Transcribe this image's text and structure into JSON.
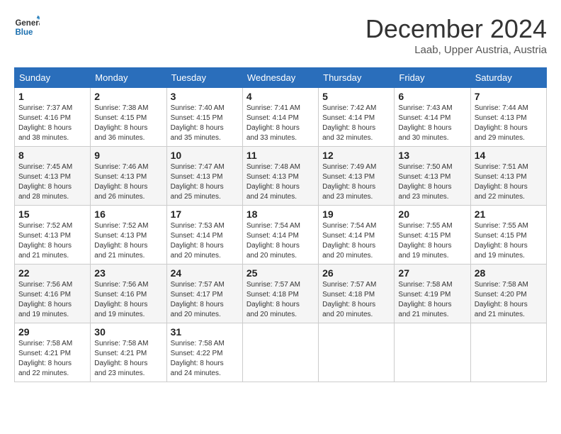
{
  "logo": {
    "line1": "General",
    "line2": "Blue"
  },
  "header": {
    "month": "December 2024",
    "location": "Laab, Upper Austria, Austria"
  },
  "days_of_week": [
    "Sunday",
    "Monday",
    "Tuesday",
    "Wednesday",
    "Thursday",
    "Friday",
    "Saturday"
  ],
  "weeks": [
    [
      {
        "day": "1",
        "sunrise": "7:37 AM",
        "sunset": "4:16 PM",
        "daylight": "8 hours and 38 minutes."
      },
      {
        "day": "2",
        "sunrise": "7:38 AM",
        "sunset": "4:15 PM",
        "daylight": "8 hours and 36 minutes."
      },
      {
        "day": "3",
        "sunrise": "7:40 AM",
        "sunset": "4:15 PM",
        "daylight": "8 hours and 35 minutes."
      },
      {
        "day": "4",
        "sunrise": "7:41 AM",
        "sunset": "4:14 PM",
        "daylight": "8 hours and 33 minutes."
      },
      {
        "day": "5",
        "sunrise": "7:42 AM",
        "sunset": "4:14 PM",
        "daylight": "8 hours and 32 minutes."
      },
      {
        "day": "6",
        "sunrise": "7:43 AM",
        "sunset": "4:14 PM",
        "daylight": "8 hours and 30 minutes."
      },
      {
        "day": "7",
        "sunrise": "7:44 AM",
        "sunset": "4:13 PM",
        "daylight": "8 hours and 29 minutes."
      }
    ],
    [
      {
        "day": "8",
        "sunrise": "7:45 AM",
        "sunset": "4:13 PM",
        "daylight": "8 hours and 28 minutes."
      },
      {
        "day": "9",
        "sunrise": "7:46 AM",
        "sunset": "4:13 PM",
        "daylight": "8 hours and 26 minutes."
      },
      {
        "day": "10",
        "sunrise": "7:47 AM",
        "sunset": "4:13 PM",
        "daylight": "8 hours and 25 minutes."
      },
      {
        "day": "11",
        "sunrise": "7:48 AM",
        "sunset": "4:13 PM",
        "daylight": "8 hours and 24 minutes."
      },
      {
        "day": "12",
        "sunrise": "7:49 AM",
        "sunset": "4:13 PM",
        "daylight": "8 hours and 23 minutes."
      },
      {
        "day": "13",
        "sunrise": "7:50 AM",
        "sunset": "4:13 PM",
        "daylight": "8 hours and 23 minutes."
      },
      {
        "day": "14",
        "sunrise": "7:51 AM",
        "sunset": "4:13 PM",
        "daylight": "8 hours and 22 minutes."
      }
    ],
    [
      {
        "day": "15",
        "sunrise": "7:52 AM",
        "sunset": "4:13 PM",
        "daylight": "8 hours and 21 minutes."
      },
      {
        "day": "16",
        "sunrise": "7:52 AM",
        "sunset": "4:13 PM",
        "daylight": "8 hours and 21 minutes."
      },
      {
        "day": "17",
        "sunrise": "7:53 AM",
        "sunset": "4:14 PM",
        "daylight": "8 hours and 20 minutes."
      },
      {
        "day": "18",
        "sunrise": "7:54 AM",
        "sunset": "4:14 PM",
        "daylight": "8 hours and 20 minutes."
      },
      {
        "day": "19",
        "sunrise": "7:54 AM",
        "sunset": "4:14 PM",
        "daylight": "8 hours and 20 minutes."
      },
      {
        "day": "20",
        "sunrise": "7:55 AM",
        "sunset": "4:15 PM",
        "daylight": "8 hours and 19 minutes."
      },
      {
        "day": "21",
        "sunrise": "7:55 AM",
        "sunset": "4:15 PM",
        "daylight": "8 hours and 19 minutes."
      }
    ],
    [
      {
        "day": "22",
        "sunrise": "7:56 AM",
        "sunset": "4:16 PM",
        "daylight": "8 hours and 19 minutes."
      },
      {
        "day": "23",
        "sunrise": "7:56 AM",
        "sunset": "4:16 PM",
        "daylight": "8 hours and 19 minutes."
      },
      {
        "day": "24",
        "sunrise": "7:57 AM",
        "sunset": "4:17 PM",
        "daylight": "8 hours and 20 minutes."
      },
      {
        "day": "25",
        "sunrise": "7:57 AM",
        "sunset": "4:18 PM",
        "daylight": "8 hours and 20 minutes."
      },
      {
        "day": "26",
        "sunrise": "7:57 AM",
        "sunset": "4:18 PM",
        "daylight": "8 hours and 20 minutes."
      },
      {
        "day": "27",
        "sunrise": "7:58 AM",
        "sunset": "4:19 PM",
        "daylight": "8 hours and 21 minutes."
      },
      {
        "day": "28",
        "sunrise": "7:58 AM",
        "sunset": "4:20 PM",
        "daylight": "8 hours and 21 minutes."
      }
    ],
    [
      {
        "day": "29",
        "sunrise": "7:58 AM",
        "sunset": "4:21 PM",
        "daylight": "8 hours and 22 minutes."
      },
      {
        "day": "30",
        "sunrise": "7:58 AM",
        "sunset": "4:21 PM",
        "daylight": "8 hours and 23 minutes."
      },
      {
        "day": "31",
        "sunrise": "7:58 AM",
        "sunset": "4:22 PM",
        "daylight": "8 hours and 24 minutes."
      },
      null,
      null,
      null,
      null
    ]
  ],
  "labels": {
    "sunrise": "Sunrise:",
    "sunset": "Sunset:",
    "daylight": "Daylight:"
  }
}
